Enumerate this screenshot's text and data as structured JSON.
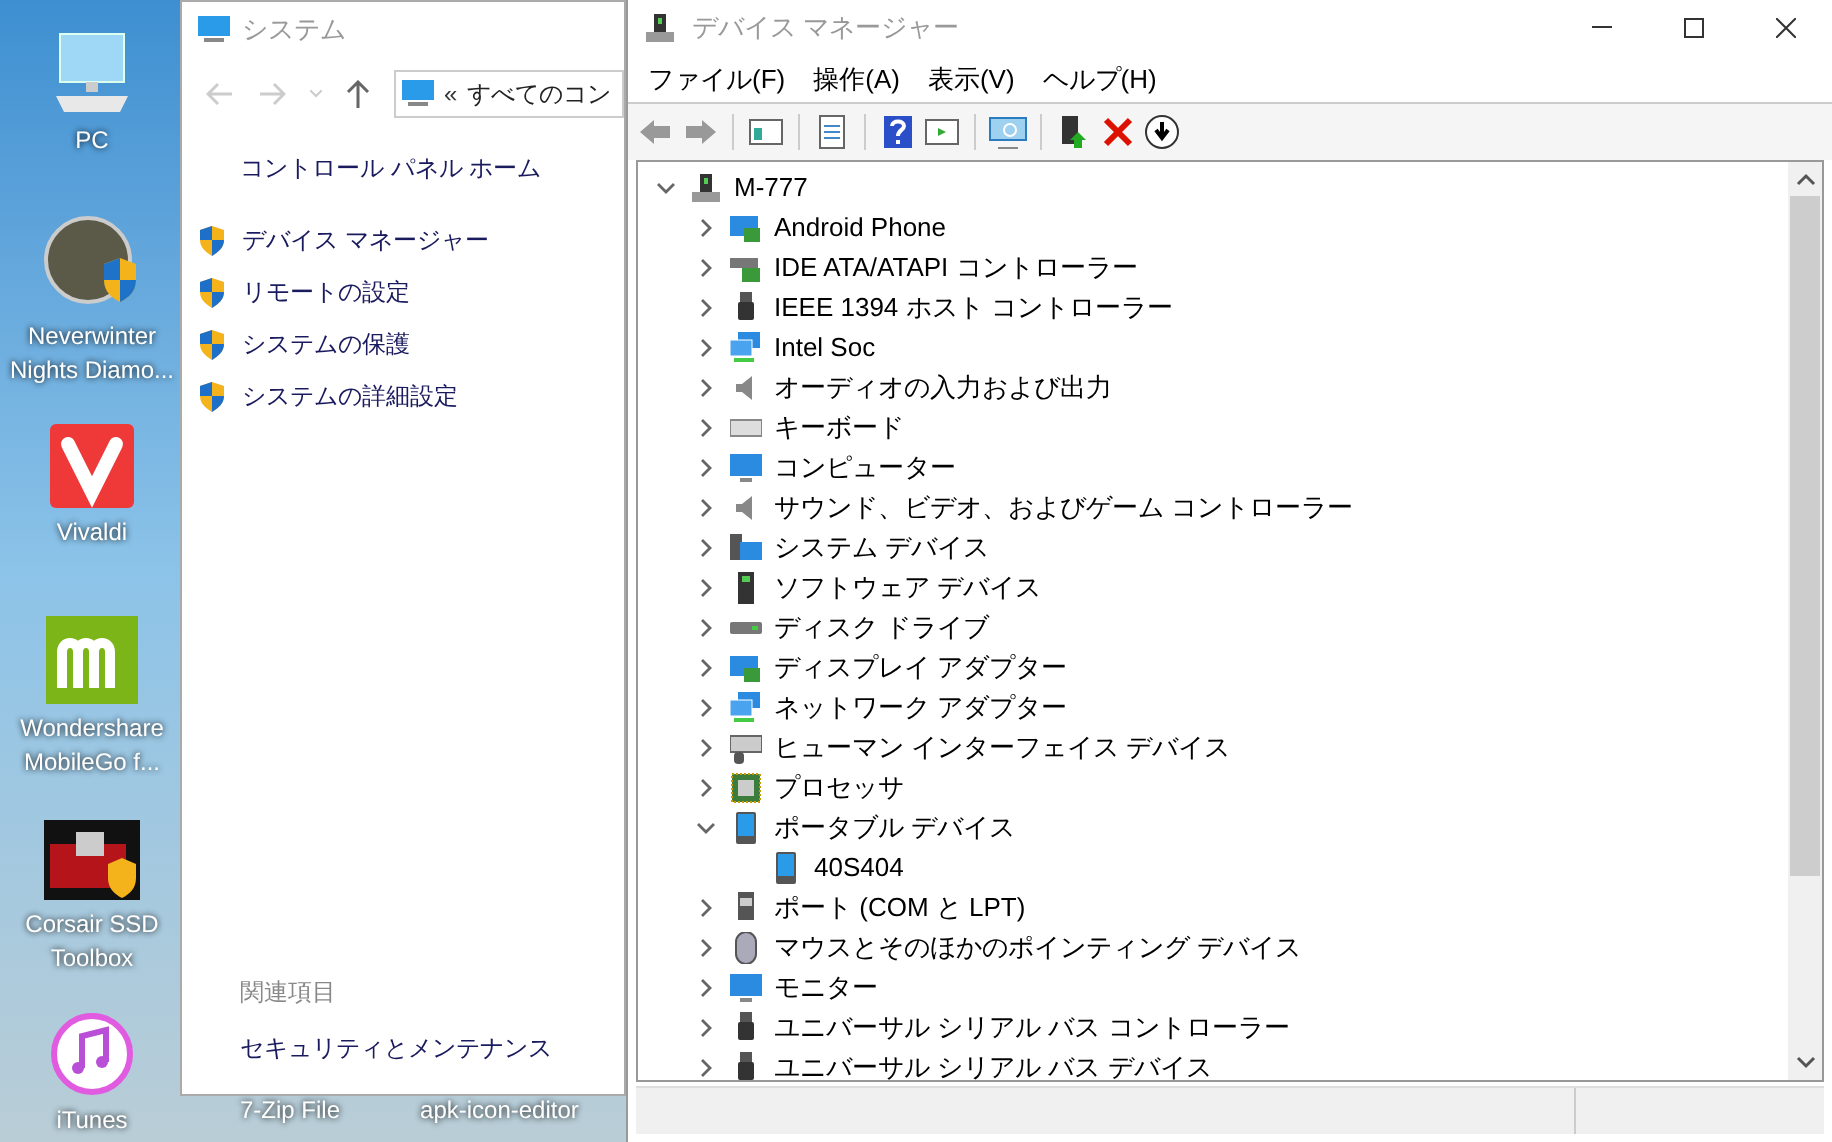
{
  "desktop_icons": [
    {
      "label": "PC",
      "kind": "pc"
    },
    {
      "label": "Neverwinter Nights Diamo...",
      "kind": "game"
    },
    {
      "label": "Vivaldi",
      "kind": "vivaldi"
    },
    {
      "label": "Wondershare MobileGo f...",
      "kind": "mobilego"
    },
    {
      "label": "Corsair SSD Toolbox",
      "kind": "toolbox"
    },
    {
      "label": "iTunes",
      "kind": "music"
    }
  ],
  "desktop_labels_bottom": [
    "7-Zip File",
    "apk-icon-editor"
  ],
  "system_window": {
    "title": "システム",
    "address_prefix": "«",
    "address": "すべてのコン",
    "home_link": "コントロール パネル ホーム",
    "links": [
      "デバイス マネージャー",
      "リモートの設定",
      "システムの保護",
      "システムの詳細設定"
    ],
    "related_heading": "関連項目",
    "related_links": [
      "セキュリティとメンテナンス"
    ]
  },
  "device_manager": {
    "title": "デバイス マネージャー",
    "menu": [
      "ファイル(F)",
      "操作(A)",
      "表示(V)",
      "ヘルプ(H)"
    ],
    "tree": {
      "label": "M-777",
      "kind": "computer",
      "expanded": true,
      "children": [
        {
          "label": "Android Phone",
          "kind": "card",
          "expanded": false
        },
        {
          "label": "IDE ATA/ATAPI コントローラー",
          "kind": "ide",
          "expanded": false
        },
        {
          "label": "IEEE 1394 ホスト コントローラー",
          "kind": "plug",
          "expanded": false
        },
        {
          "label": "Intel Soc",
          "kind": "network",
          "expanded": false
        },
        {
          "label": "オーディオの入力および出力",
          "kind": "speaker",
          "expanded": false
        },
        {
          "label": "キーボード",
          "kind": "keyboard",
          "expanded": false
        },
        {
          "label": "コンピューター",
          "kind": "monitor",
          "expanded": false
        },
        {
          "label": "サウンド、ビデオ、およびゲーム コントローラー",
          "kind": "speaker",
          "expanded": false
        },
        {
          "label": "システム デバイス",
          "kind": "system",
          "expanded": false
        },
        {
          "label": "ソフトウェア デバイス",
          "kind": "tower",
          "expanded": false
        },
        {
          "label": "ディスク ドライブ",
          "kind": "disk",
          "expanded": false
        },
        {
          "label": "ディスプレイ アダプター",
          "kind": "card",
          "expanded": false
        },
        {
          "label": "ネットワーク アダプター",
          "kind": "network",
          "expanded": false
        },
        {
          "label": "ヒューマン インターフェイス デバイス",
          "kind": "hid",
          "expanded": false
        },
        {
          "label": "プロセッサ",
          "kind": "chip",
          "expanded": false
        },
        {
          "label": "ポータブル デバイス",
          "kind": "portable",
          "expanded": true,
          "children": [
            {
              "label": "40S404",
              "kind": "portable"
            }
          ]
        },
        {
          "label": "ポート (COM と LPT)",
          "kind": "port",
          "expanded": false
        },
        {
          "label": "マウスとそのほかのポインティング デバイス",
          "kind": "mouse",
          "expanded": false
        },
        {
          "label": "モニター",
          "kind": "monitor",
          "expanded": false
        },
        {
          "label": "ユニバーサル シリアル バス コントローラー",
          "kind": "plug",
          "expanded": false
        },
        {
          "label": "ユニバーサル シリアル バス デバイス",
          "kind": "plug",
          "expanded": false
        }
      ]
    }
  }
}
